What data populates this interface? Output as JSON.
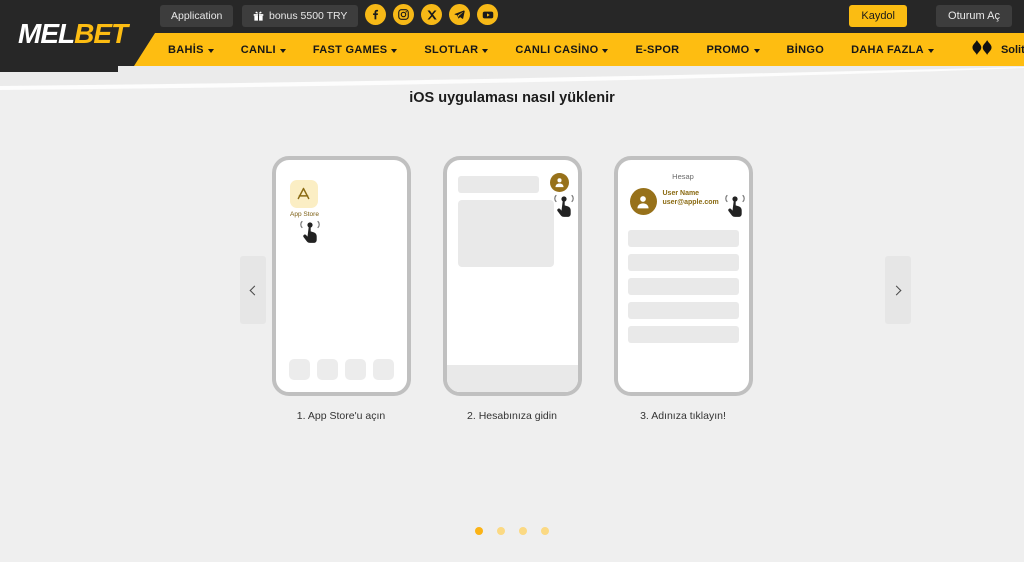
{
  "brand": {
    "logo_primary": "MEL",
    "logo_secondary": "BET",
    "accent_yellow": "#febd11",
    "accent_dark": "#272727"
  },
  "topbar": {
    "application_label": "Application",
    "bonus_label": "bonus 5500 TRY",
    "gift_icon": "gift-icon",
    "socials": [
      {
        "name": "facebook-icon",
        "label": "Facebook"
      },
      {
        "name": "instagram-icon",
        "label": "Instagram"
      },
      {
        "name": "x-twitter-icon",
        "label": "X"
      },
      {
        "name": "telegram-icon",
        "label": "Telegram"
      },
      {
        "name": "youtube-icon",
        "label": "YouTube"
      }
    ],
    "register_label": "Kaydol",
    "login_label": "Oturum Aç"
  },
  "nav": {
    "items": [
      {
        "label": "BAHİS",
        "has_caret": true
      },
      {
        "label": "CANLI",
        "has_caret": true
      },
      {
        "label": "FAST GAMES",
        "has_caret": true
      },
      {
        "label": "SLOTLAR",
        "has_caret": true
      },
      {
        "label": "CANLI CASİNO",
        "has_caret": true
      },
      {
        "label": "E-SPOR",
        "has_caret": false
      },
      {
        "label": "PROMO",
        "has_caret": true
      },
      {
        "label": "BİNGO",
        "has_caret": false
      },
      {
        "label": "DAHA FAZLA",
        "has_caret": true
      }
    ],
    "solitaire_label": "Solitaire",
    "solitaire_icon": "solitaire-diamonds-icon"
  },
  "main": {
    "title": "iOS uygulaması nasıl yüklenir",
    "prev_arrow_icon": "chevron-left-icon",
    "next_arrow_icon": "chevron-right-icon",
    "steps": [
      {
        "caption": "1. App Store'u açın",
        "app_label": "App Store",
        "app_icon": "app-store-icon",
        "tap_icon": "tap-hand-icon"
      },
      {
        "caption": "2. Hesabınıza gidin",
        "avatar_icon": "user-avatar-icon",
        "tap_icon": "tap-hand-icon"
      },
      {
        "caption": "3. Adınıza tıklayın!",
        "screen_title": "Hesap",
        "user_name": "User Name",
        "user_email": "user@apple.com",
        "avatar_icon": "user-avatar-icon",
        "tap_icon": "tap-hand-icon"
      }
    ],
    "pagination": {
      "total": 4,
      "active_index": 0
    }
  }
}
